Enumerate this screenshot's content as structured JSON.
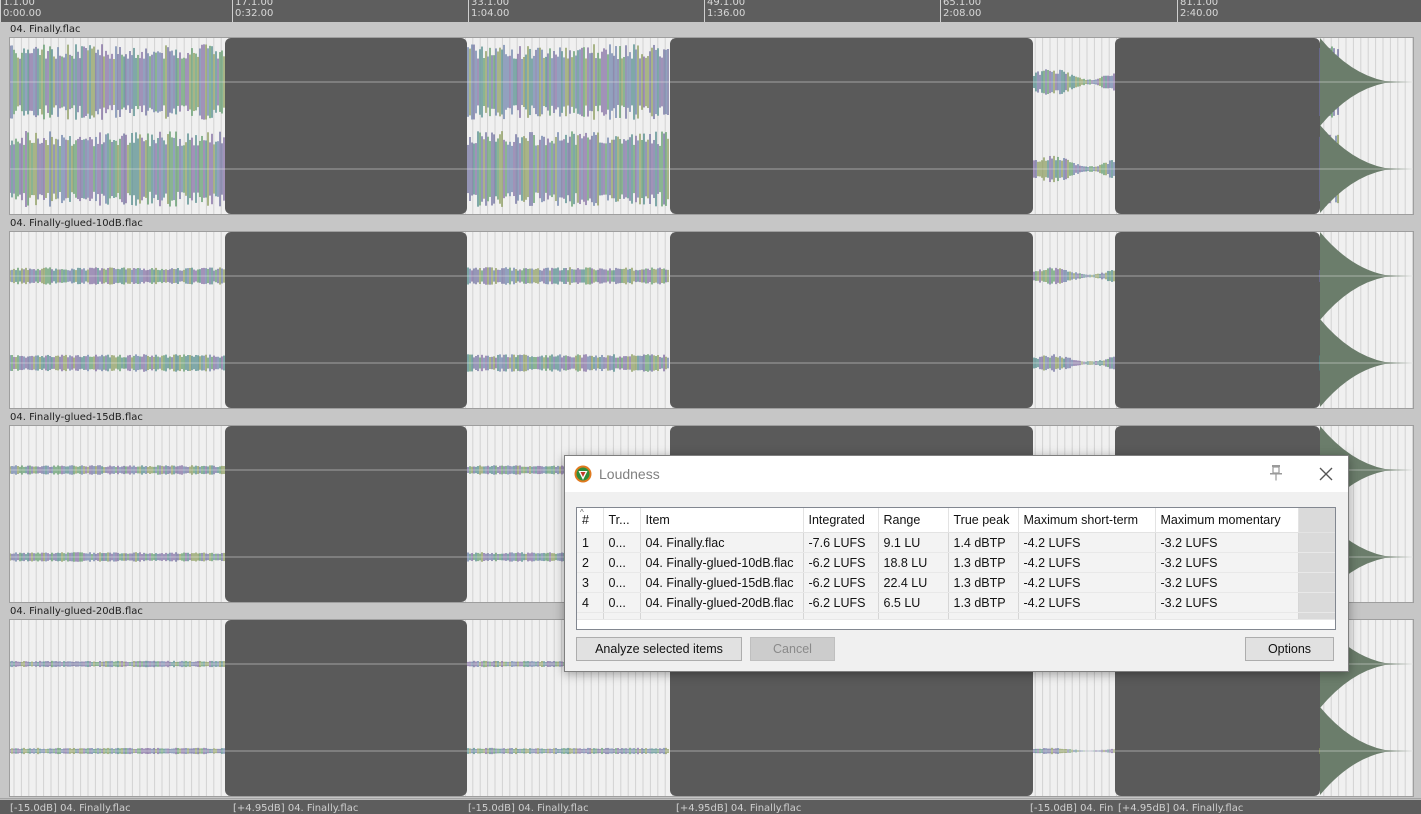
{
  "ruler": {
    "marks": [
      {
        "bar": "1.1.00",
        "time": "0:00.00"
      },
      {
        "bar": "17.1.00",
        "time": "0:32.00"
      },
      {
        "bar": "33.1.00",
        "time": "1:04.00"
      },
      {
        "bar": "49.1.00",
        "time": "1:36.00"
      },
      {
        "bar": "65.1.00",
        "time": "2:08.00"
      },
      {
        "bar": "81.1.00",
        "time": "2:40.00"
      }
    ]
  },
  "tracks": [
    {
      "name": "04. Finally.flac"
    },
    {
      "name": "04. Finally-glued-10dB.flac"
    },
    {
      "name": "04. Finally-glued-15dB.flac"
    },
    {
      "name": "04. Finally-glued-20dB.flac"
    }
  ],
  "bottom_segments": [
    "[-15.0dB] 04. Finally.flac",
    "[+4.95dB] 04. Finally.flac",
    "[-15.0dB] 04. Finally.flac",
    "[+4.95dB] 04. Finally.flac",
    "[-15.0dB] 04. Fin",
    "[+4.95dB] 04. Finally.flac"
  ],
  "dialog": {
    "title": "Loudness",
    "columns": [
      "#",
      "Tr...",
      "Item",
      "Integrated",
      "Range",
      "True peak",
      "Maximum short-term",
      "Maximum momentary"
    ],
    "rows": [
      [
        "1",
        "0...",
        "04. Finally.flac",
        "-7.6 LUFS",
        "9.1 LU",
        "1.4 dBTP",
        "-4.2 LUFS",
        "-3.2 LUFS"
      ],
      [
        "2",
        "0...",
        "04. Finally-glued-10dB.flac",
        "-6.2 LUFS",
        "18.8 LU",
        "1.3 dBTP",
        "-4.2 LUFS",
        "-3.2 LUFS"
      ],
      [
        "3",
        "0...",
        "04. Finally-glued-15dB.flac",
        "-6.2 LUFS",
        "22.4 LU",
        "1.3 dBTP",
        "-4.2 LUFS",
        "-3.2 LUFS"
      ],
      [
        "4",
        "0...",
        "04. Finally-glued-20dB.flac",
        "-6.2 LUFS",
        "6.5 LU",
        "1.3 dBTP",
        "-4.2 LUFS",
        "-3.2 LUFS"
      ]
    ],
    "buttons": {
      "analyze": "Analyze selected items",
      "cancel": "Cancel",
      "options": "Options"
    },
    "icons": {
      "app": "reaper-logo-icon",
      "pin": "pin-icon",
      "close": "close-icon"
    }
  },
  "colors": {
    "waveform_dark": "#5a5a5a",
    "waveform_light_bg": "#f0f0f0",
    "ruler_bg": "#5e5e5e"
  }
}
